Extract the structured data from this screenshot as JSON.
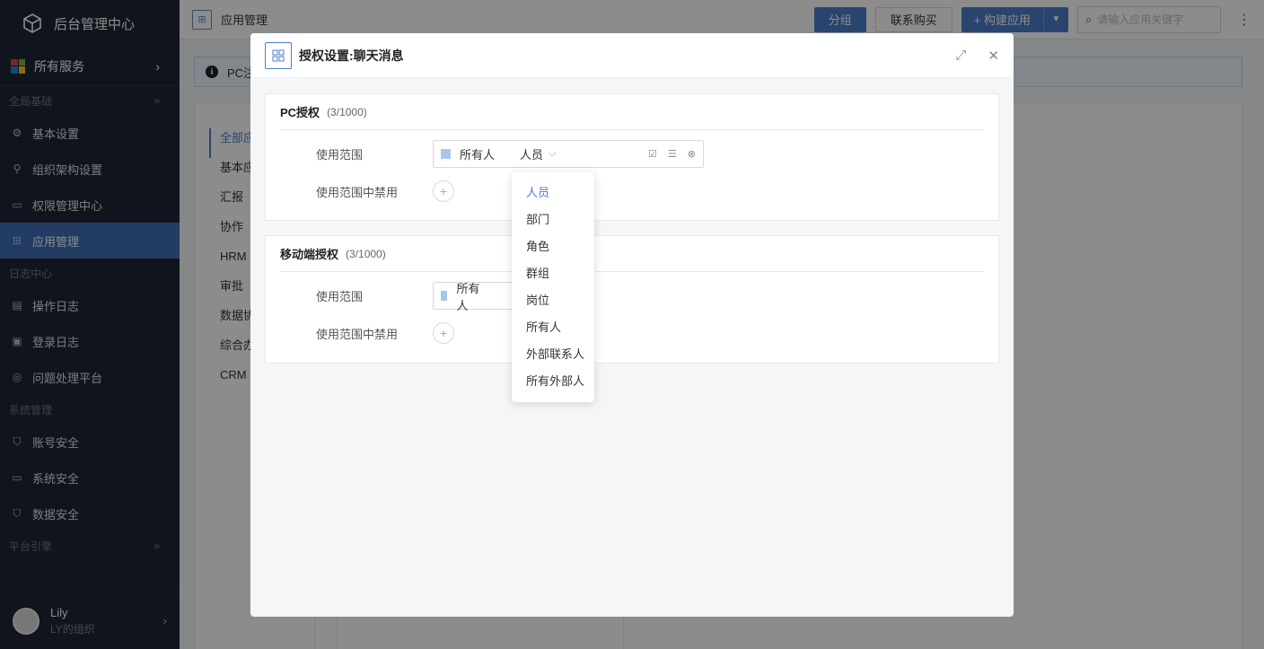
{
  "sidebar": {
    "brand": "后台管理中心",
    "all_services": "所有服务",
    "sections": [
      {
        "title": "全局基础",
        "items": [
          "基本设置",
          "组织架构设置",
          "权限管理中心",
          "应用管理"
        ]
      },
      {
        "title": "日志中心",
        "items": [
          "操作日志",
          "登录日志",
          "问题处理平台"
        ]
      },
      {
        "title": "系统管理",
        "items": [
          "账号安全",
          "系统安全",
          "数据安全"
        ]
      },
      {
        "title": "平台引擎",
        "items": []
      }
    ],
    "active_item": "应用管理",
    "user": {
      "name": "Lily",
      "org": "LY的组织"
    }
  },
  "topbar": {
    "title": "应用管理",
    "group_btn": "分组",
    "buy_btn": "联系购买",
    "build_btn": "+ 构建应用",
    "search_placeholder": "请输入应用关键字"
  },
  "notice": {
    "text": "PC注"
  },
  "categories": [
    "全部应",
    "基本应",
    "汇报",
    "协作",
    "HRM",
    "审批",
    "数据协",
    "综合办",
    "CRM"
  ],
  "modal": {
    "title": "授权设置:聊天消息",
    "pc": {
      "title": "PC授权",
      "count": "(3/1000)",
      "scope_label": "使用范围",
      "scope_value": "所有人",
      "scope_type": "人员",
      "ban_label": "使用范围中禁用"
    },
    "mobile": {
      "title": "移动端授权",
      "count": "(3/1000)",
      "scope_label": "使用范围",
      "scope_value": "所有人",
      "ban_label": "使用范围中禁用"
    },
    "dropdown": {
      "options": [
        "人员",
        "部门",
        "角色",
        "群组",
        "岗位",
        "所有人",
        "外部联系人",
        "所有外部人"
      ],
      "selected": "人员"
    }
  },
  "colors": {
    "primary": "#4b7fcb",
    "sidebar_bg": "#1e2736",
    "active_nav": "#3e6eb4"
  }
}
